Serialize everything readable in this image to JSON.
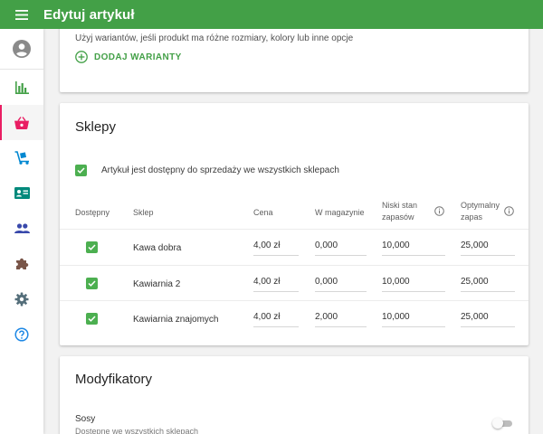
{
  "header": {
    "title": "Edytuj artykuł",
    "accent": "#43a047"
  },
  "sidebar": {
    "items": [
      {
        "icon": "account-icon",
        "active": false
      },
      {
        "icon": "bar-chart-icon",
        "active": false
      },
      {
        "icon": "basket-icon",
        "active": true,
        "color": "#e91e63"
      },
      {
        "icon": "dolly-icon",
        "active": false
      },
      {
        "icon": "id-card-icon",
        "active": false
      },
      {
        "icon": "people-icon",
        "active": false
      },
      {
        "icon": "puzzle-icon",
        "active": false
      },
      {
        "icon": "gear-icon",
        "active": false
      },
      {
        "icon": "help-icon",
        "active": false
      }
    ]
  },
  "variants": {
    "hint": "Użyj wariantów, jeśli produkt ma różne rozmiary, kolory lub inne opcje",
    "add_label": "DODAJ WARIANTY"
  },
  "stores": {
    "title": "Sklepy",
    "available_all_label": "Artykuł jest dostępny do sprzedaży we wszystkich sklepach",
    "available_all_checked": true,
    "columns": {
      "available": "Dostępny",
      "store": "Sklep",
      "price": "Cena",
      "in_stock": "W magazynie",
      "low_stock_1": "Niski stan",
      "low_stock_2": "zapasów",
      "optimal_1": "Optymalny",
      "optimal_2": "zapas"
    },
    "rows": [
      {
        "checked": true,
        "name": "Kawa dobra",
        "price": "4,00 zł",
        "in_stock": "0,000",
        "low_stock": "10,000",
        "optimal": "25,000"
      },
      {
        "checked": true,
        "name": "Kawiarnia 2",
        "price": "4,00 zł",
        "in_stock": "0,000",
        "low_stock": "10,000",
        "optimal": "25,000"
      },
      {
        "checked": true,
        "name": "Kawiarnia znajomych",
        "price": "4,00 zł",
        "in_stock": "2,000",
        "low_stock": "10,000",
        "optimal": "25,000"
      }
    ]
  },
  "modifiers": {
    "title": "Modyfikatory",
    "items": [
      {
        "name": "Sosy",
        "subtitle": "Dostępne we wszystkich sklepach",
        "enabled": false
      }
    ]
  }
}
